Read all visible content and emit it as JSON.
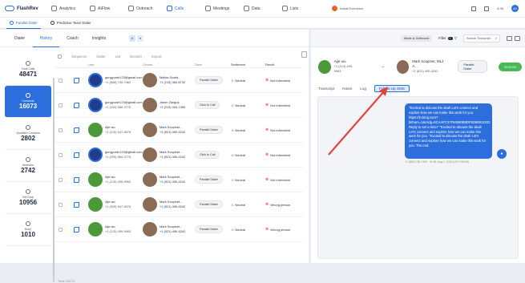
{
  "app": {
    "name": "FlashRev"
  },
  "nav": [
    {
      "label": "Analytics",
      "icon": "analytics-icon",
      "active": false
    },
    {
      "label": "AIFlow",
      "icon": "aiflow-icon",
      "active": false
    },
    {
      "label": "Outreach",
      "icon": "outreach-icon",
      "active": false
    },
    {
      "label": "Calls",
      "icon": "phone-icon",
      "active": true
    },
    {
      "label": "Meetings",
      "icon": "calendar-icon",
      "active": false
    },
    {
      "label": "Data",
      "icon": "data-icon",
      "active": false
    },
    {
      "label": "Lists",
      "icon": "list-icon",
      "active": false
    }
  ],
  "extension": "Install Extension",
  "topright": {
    "time": "8:36",
    "avatar": "xD"
  },
  "subnav": [
    {
      "label": "Parallel Dialer",
      "active": true
    },
    {
      "label": "Predictive Team Dialer",
      "active": false
    }
  ],
  "left_tabs": [
    {
      "label": "Dialer",
      "active": false
    },
    {
      "label": "History",
      "active": true
    },
    {
      "label": "Coach",
      "active": false
    },
    {
      "label": "Insights",
      "active": false
    }
  ],
  "stats": [
    {
      "label": "Total Calls",
      "value": "48471",
      "active": false
    },
    {
      "label": "Connects",
      "value": "16073",
      "active": true
    },
    {
      "label": "Qualified Contacts",
      "value": "2802",
      "active": false
    },
    {
      "label": "Abandon",
      "value": "2742",
      "active": false
    },
    {
      "label": "VM Drop",
      "value": "10956",
      "active": false
    },
    {
      "label": "Busy",
      "value": "1010",
      "active": false
    }
  ],
  "toolbar": [
    "Sequence",
    "Dialer",
    "List",
    "Booster",
    "Export"
  ],
  "columns": [
    "User",
    "Contact",
    "Dialer",
    "Sentiment",
    "Result"
  ],
  "rows": [
    {
      "user": "gongyuner123@gmail.com",
      "user_phone": "+1 (608) 749-7462",
      "contact": "Melina Scotts",
      "contact_phone": "+1 (213) 363-8732",
      "dialer": "Parallel Dialer",
      "sentiment": "Neutral",
      "result": "Not interested"
    },
    {
      "user": "gongyuner123@gmail.com",
      "user_phone": "+1 (209) 560-3775",
      "contact": "Jason Zangus",
      "contact_phone": "+1 (213) 434-7495",
      "dialer": "Click to Call",
      "sentiment": "Neutral",
      "result": "Not interested"
    },
    {
      "user": "Ajie wu",
      "user_phone": "+1 (213) 547-4576",
      "contact": "Mark Soupinet...",
      "contact_phone": "+1 (521) 490-4242",
      "dialer": "Parallel Dialer",
      "sentiment": "Neutral",
      "result": "Not interested"
    },
    {
      "user": "gongyuner123@gmail.com",
      "user_phone": "+1 (209) 560-3775",
      "contact": "Mark Soupinet...",
      "contact_phone": "+1 (521) 490-4242",
      "dialer": "Click to Call",
      "sentiment": "Neutral",
      "result": "Not interested"
    },
    {
      "user": "Ajie wu",
      "user_phone": "+1 (213) 490-9963",
      "contact": "Mark Soupinet...",
      "contact_phone": "+1 (521) 490-4242",
      "dialer": "Parallel Dialer",
      "sentiment": "Neutral",
      "result": "Not interested"
    },
    {
      "user": "Ajie wu",
      "user_phone": "+1 (929) 547-4576",
      "contact": "Mark Soupinet...",
      "contact_phone": "+1 (521) 490-4242",
      "dialer": "Parallel Dialer",
      "sentiment": "Neutral",
      "result": "Wrong person"
    },
    {
      "user": "Ajie wu",
      "user_phone": "+1 (213) 490-9963",
      "contact": "Mark Soupinet...",
      "contact_phone": "+1 (521) 490-4242",
      "dialer": "Parallel Dialer",
      "sentiment": "Neutral",
      "result": "Wrong person"
    }
  ],
  "footer": "Total 16073",
  "right": {
    "mode": "Mode is Outbound",
    "filter_label": "Filter",
    "filter_count": "1",
    "search_placeholder": "Search Transcript",
    "caller_name": "Ajie wu",
    "caller_phone": "+1 (213) 490-9963",
    "callee_name": "Mark Soupinet, MLJ A...",
    "callee_phone": "+1 (521) 490-4242",
    "dialer_pill": "Parallel Dialer",
    "timer": "00:00:04",
    "tabs": [
      {
        "label": "Transcript",
        "active": false
      },
      {
        "label": "Notes",
        "active": false
      },
      {
        "label": "Log",
        "active": false
      },
      {
        "label": "Follow-Up SMS",
        "active": true
      }
    ],
    "sms_text": "\"Excited to discuss the deal! Let's connect and explore how we can make this work for you. https://in.bing.com?bitham=1&csdg=6CAAFC37F94080B8DF6D86913202 Reply to set a time!\" \"Excited to discuss the deal! Let's connect and explore how we can make this work for you. \"Excited to discuss the deal! Let's connect and explore how we can make this work for you. The end.",
    "sms_meta": "+1 (850) 735-7109 · 11:36, Aug 2, 2023 (UTC+08:00)",
    "accent": "#2c6fdc"
  }
}
